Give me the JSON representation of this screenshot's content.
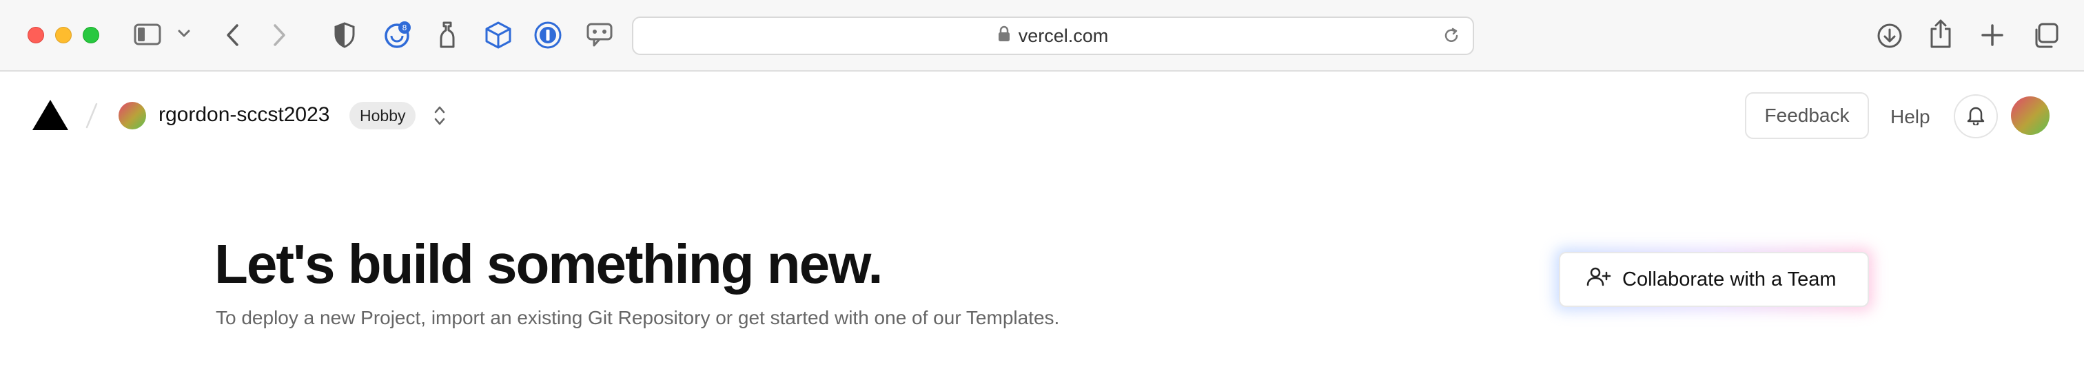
{
  "browser": {
    "url": "vercel.com",
    "toolbar_icons": [
      "sidebar-toggle-icon",
      "chevron-down-icon",
      "back-arrow-icon",
      "forward-arrow-icon",
      "shield-icon",
      "extension-badge-icon",
      "bottle-icon",
      "cube-icon",
      "password-manager-icon",
      "chat-icon"
    ],
    "right_icons": [
      "download-icon",
      "share-icon",
      "new-tab-icon",
      "tabs-overview-icon"
    ]
  },
  "header": {
    "team_name": "rgordon-sccst2023",
    "plan_badge": "Hobby",
    "feedback_label": "Feedback",
    "help_label": "Help"
  },
  "hero": {
    "title": "Let's build something new.",
    "subtitle": "To deploy a new Project, import an existing Git Repository or get started with one of our Templates."
  },
  "actions": {
    "collaborate_label": "Collaborate with a Team"
  },
  "colors": {
    "traffic_close": "#fe5f57",
    "traffic_minimize": "#febc2e",
    "traffic_maximize": "#28c840",
    "extension_blue": "#2f6bd8"
  }
}
